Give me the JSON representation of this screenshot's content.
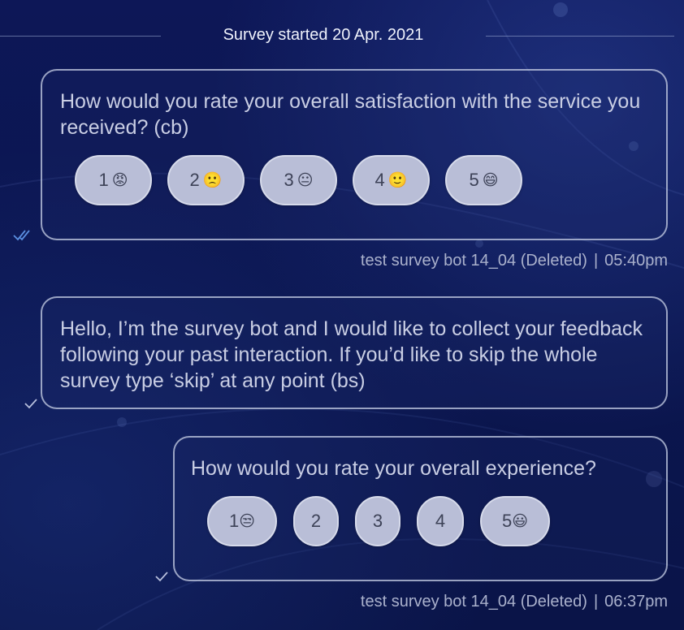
{
  "divider": {
    "label": "Survey started 20 Apr. 2021"
  },
  "messages": [
    {
      "text": "How would you rate your overall satisfaction with the service you received? (cb)",
      "options": [
        {
          "label": "1",
          "emoji": "😡"
        },
        {
          "label": "2",
          "emoji": "🙁"
        },
        {
          "label": "3",
          "emoji": "😐"
        },
        {
          "label": "4",
          "emoji": "🙂"
        },
        {
          "label": "5",
          "emoji": "😄"
        }
      ],
      "status_icon": "double-check-icon",
      "sender": "test survey bot 14_04 (Deleted)",
      "time": "05:40pm"
    },
    {
      "text": "Hello, I’m the survey bot and I would like to collect your feedback following your past interaction. If you’d like to skip the whole survey type ‘skip’ at any point (bs)",
      "status_icon": "check-icon"
    },
    {
      "text": "How would you rate your overall experience?",
      "options": [
        {
          "label": "1",
          "emoji": "😒"
        },
        {
          "label": "2",
          "emoji": ""
        },
        {
          "label": "3",
          "emoji": ""
        },
        {
          "label": "4",
          "emoji": ""
        },
        {
          "label": "5",
          "emoji": "😃"
        }
      ],
      "status_icon": "check-icon",
      "sender": "test survey bot 14_04 (Deleted)",
      "time": "06:37pm"
    }
  ],
  "separator": "|",
  "colors": {
    "background": "#0c1652",
    "bubble_border": "#c8d0e6",
    "option_fill": "#b9bed7",
    "read_check": "#5a8fe0"
  }
}
